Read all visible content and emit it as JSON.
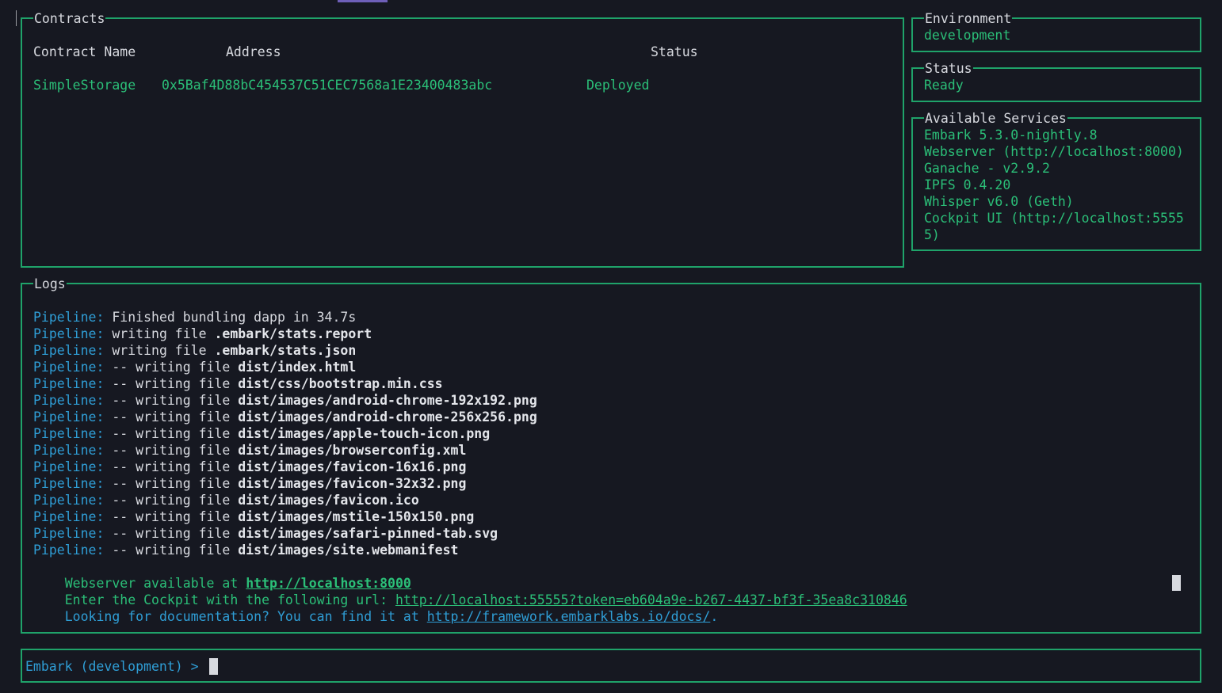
{
  "contracts_panel": {
    "title": "Contracts",
    "headers": {
      "name": "Contract Name",
      "address": "Address",
      "status": "Status"
    },
    "rows": [
      {
        "name": "SimpleStorage",
        "address": "0x5Baf4D88bC454537C51CEC7568a1E23400483abc",
        "status": "Deployed"
      }
    ]
  },
  "environment_panel": {
    "title": "Environment",
    "value": "development"
  },
  "status_panel": {
    "title": "Status",
    "value": "Ready"
  },
  "services_panel": {
    "title": "Available Services",
    "items": [
      "Embark 5.3.0-nightly.8",
      "Webserver (http://localhost:8000)",
      "Ganache - v2.9.2",
      "IPFS 0.4.20",
      "Whisper v6.0 (Geth)",
      "Cockpit UI (http://localhost:5555",
      "5)"
    ]
  },
  "logs_panel": {
    "title": "Logs",
    "pipeline_lines": [
      {
        "prefix": "Pipeline:",
        "text": " Finished bundling dapp in 34.7s",
        "file": ""
      },
      {
        "prefix": "Pipeline:",
        "text": " writing file ",
        "file": ".embark/stats.report"
      },
      {
        "prefix": "Pipeline:",
        "text": " writing file ",
        "file": ".embark/stats.json"
      },
      {
        "prefix": "Pipeline:",
        "text": " -- writing file ",
        "file": "dist/index.html"
      },
      {
        "prefix": "Pipeline:",
        "text": " -- writing file ",
        "file": "dist/css/bootstrap.min.css"
      },
      {
        "prefix": "Pipeline:",
        "text": " -- writing file ",
        "file": "dist/images/android-chrome-192x192.png"
      },
      {
        "prefix": "Pipeline:",
        "text": " -- writing file ",
        "file": "dist/images/android-chrome-256x256.png"
      },
      {
        "prefix": "Pipeline:",
        "text": " -- writing file ",
        "file": "dist/images/apple-touch-icon.png"
      },
      {
        "prefix": "Pipeline:",
        "text": " -- writing file ",
        "file": "dist/images/browserconfig.xml"
      },
      {
        "prefix": "Pipeline:",
        "text": " -- writing file ",
        "file": "dist/images/favicon-16x16.png"
      },
      {
        "prefix": "Pipeline:",
        "text": " -- writing file ",
        "file": "dist/images/favicon-32x32.png"
      },
      {
        "prefix": "Pipeline:",
        "text": " -- writing file ",
        "file": "dist/images/favicon.ico"
      },
      {
        "prefix": "Pipeline:",
        "text": " -- writing file ",
        "file": "dist/images/mstile-150x150.png"
      },
      {
        "prefix": "Pipeline:",
        "text": " -- writing file ",
        "file": "dist/images/safari-pinned-tab.svg"
      },
      {
        "prefix": "Pipeline:",
        "text": " -- writing file ",
        "file": "dist/images/site.webmanifest"
      }
    ],
    "webserver_line": {
      "text": "Webserver available at ",
      "link": "http://localhost:8000"
    },
    "cockpit_line": {
      "text": "Enter the Cockpit with the following url: ",
      "link": "http://localhost:55555?token=eb604a9e-b267-4437-bf3f-35ea8c310846"
    },
    "docs_line": {
      "text": "Looking for documentation? You can find it at ",
      "link": "http://framework.embarklabs.io/docs/",
      "suffix": "."
    }
  },
  "console": {
    "prompt": "Embark (development) > ",
    "value": ""
  },
  "colors": {
    "border": "#1fa36a",
    "green_text": "#2bbf78",
    "blue_text": "#2f9ed6",
    "background": "#161821"
  }
}
